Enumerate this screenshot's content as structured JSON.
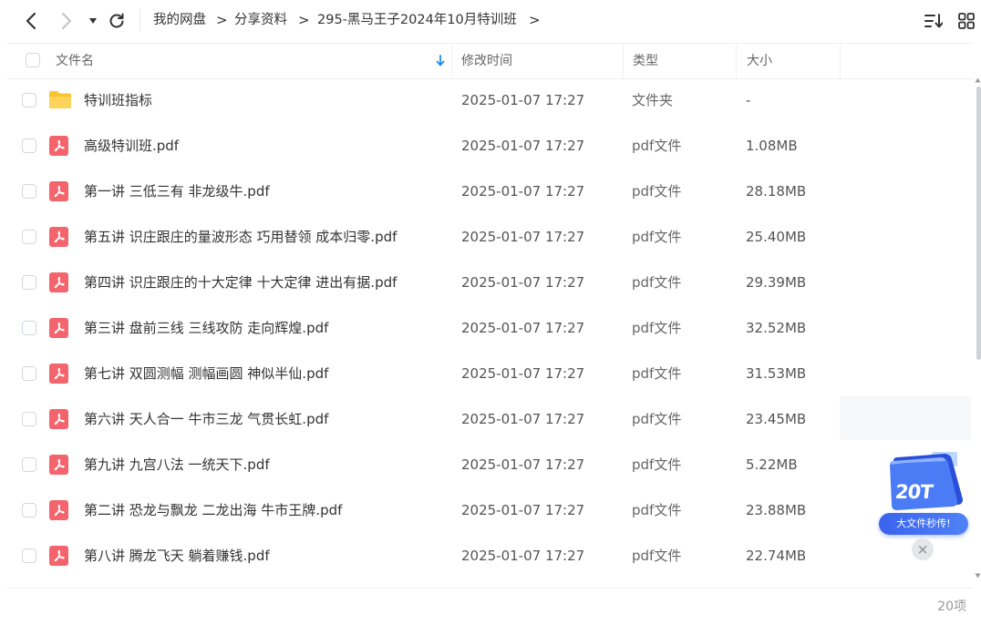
{
  "breadcrumb": [
    "我的网盘",
    "分享资料",
    "295-黑马王子2024年10月特训班"
  ],
  "columns": {
    "name": "文件名",
    "modified": "修改时间",
    "type": "类型",
    "size": "大小"
  },
  "files": [
    {
      "name": "特训班指标",
      "modified": "2025-01-07 17:27",
      "type": "文件夹",
      "size": "-",
      "icon": "folder"
    },
    {
      "name": "高级特训班.pdf",
      "modified": "2025-01-07 17:27",
      "type": "pdf文件",
      "size": "1.08MB",
      "icon": "pdf"
    },
    {
      "name": "第一讲 三低三有 非龙级牛.pdf",
      "modified": "2025-01-07 17:27",
      "type": "pdf文件",
      "size": "28.18MB",
      "icon": "pdf"
    },
    {
      "name": "第五讲 识庄跟庄的量波形态 巧用替领 成本归零.pdf",
      "modified": "2025-01-07 17:27",
      "type": "pdf文件",
      "size": "25.40MB",
      "icon": "pdf"
    },
    {
      "name": "第四讲 识庄跟庄的十大定律 十大定律 进出有据.pdf",
      "modified": "2025-01-07 17:27",
      "type": "pdf文件",
      "size": "29.39MB",
      "icon": "pdf"
    },
    {
      "name": "第三讲 盘前三线 三线攻防 走向辉煌.pdf",
      "modified": "2025-01-07 17:27",
      "type": "pdf文件",
      "size": "32.52MB",
      "icon": "pdf"
    },
    {
      "name": "第七讲 双圆测幅 测幅画圆 神似半仙.pdf",
      "modified": "2025-01-07 17:27",
      "type": "pdf文件",
      "size": "31.53MB",
      "icon": "pdf"
    },
    {
      "name": "第六讲 天人合一 牛市三龙 气贯长虹.pdf",
      "modified": "2025-01-07 17:27",
      "type": "pdf文件",
      "size": "23.45MB",
      "icon": "pdf"
    },
    {
      "name": "第九讲 九宫八法 一统天下.pdf",
      "modified": "2025-01-07 17:27",
      "type": "pdf文件",
      "size": "5.22MB",
      "icon": "pdf"
    },
    {
      "name": "第二讲 恐龙与飘龙 二龙出海 牛市王牌.pdf",
      "modified": "2025-01-07 17:27",
      "type": "pdf文件",
      "size": "23.88MB",
      "icon": "pdf"
    },
    {
      "name": "第八讲 腾龙飞天 躺着赚钱.pdf",
      "modified": "2025-01-07 17:27",
      "type": "pdf文件",
      "size": "22.74MB",
      "icon": "pdf"
    }
  ],
  "footer": {
    "count": "20项"
  },
  "promo": {
    "badge": "20T",
    "label": "大文件秒传!"
  },
  "colors": {
    "pdf": "#f3646c",
    "folder": "#fcc42c",
    "accent": "#1f8cf2",
    "promo_blue": "#3d6cf0"
  }
}
